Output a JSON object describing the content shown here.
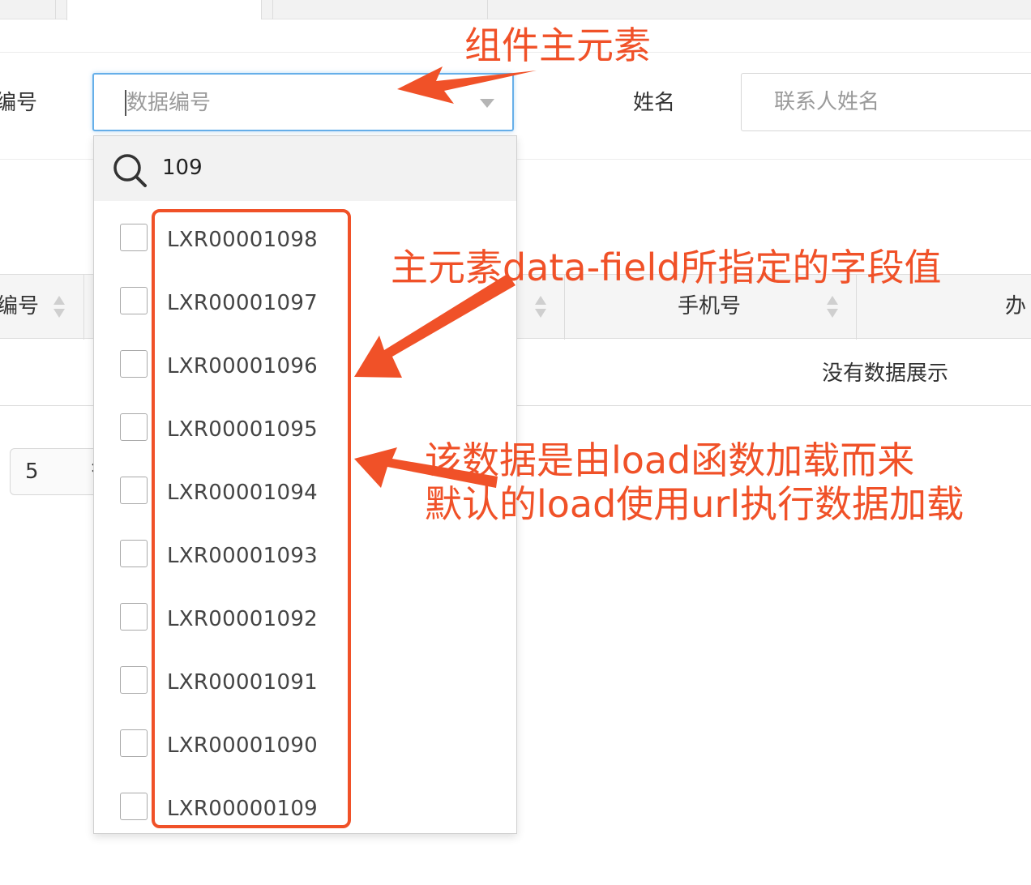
{
  "form": {
    "field1_label_partial": "编号",
    "field1_placeholder": "数据编号",
    "field2_label": "姓名",
    "field2_placeholder": "联系人姓名"
  },
  "table": {
    "columns": [
      {
        "label": "编号"
      },
      {
        "label": "手机号"
      },
      {
        "label": "办"
      }
    ],
    "empty_message": "没有数据展示",
    "page_size": "5",
    "page_size_spinner": "⇕"
  },
  "dropdown": {
    "search_query": "109",
    "options": [
      "LXR00001098",
      "LXR00001097",
      "LXR00001096",
      "LXR00001095",
      "LXR00001094",
      "LXR00001093",
      "LXR00001092",
      "LXR00001091",
      "LXR00001090",
      "LXR00000109"
    ]
  },
  "annotations": {
    "main_element": "组件主元素",
    "data_field_note": "主元素data-field所指定的字段值",
    "load_note_line1": "该数据是由load函数加载而来",
    "load_note_line2": "默认的load使用url执行数据加载"
  },
  "colors": {
    "annotation": "#f05128",
    "focus_border": "#66afe9",
    "header_bg": "#f5f5f5"
  }
}
